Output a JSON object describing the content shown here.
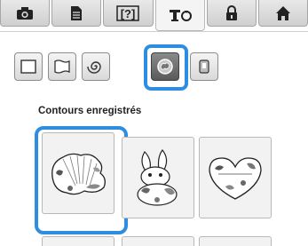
{
  "tabs": [
    {
      "icon": "camera-icon"
    },
    {
      "icon": "document-icon"
    },
    {
      "icon": "unknown-pattern-icon",
      "label": "[?]"
    },
    {
      "icon": "sewing-machine-icon"
    },
    {
      "icon": "lock-icon"
    },
    {
      "icon": "home-icon"
    }
  ],
  "shape_tools": [
    {
      "icon": "square-outline-icon",
      "selected": false
    },
    {
      "icon": "wavy-frame-icon",
      "selected": false
    },
    {
      "icon": "spiral-icon",
      "selected": false
    },
    {
      "icon": "saved-outline-icon",
      "selected": true
    },
    {
      "icon": "frame-icon",
      "selected": false
    }
  ],
  "section": {
    "title": "Contours enregistrés"
  },
  "saved_outlines": [
    {
      "icon": "shell-outline-icon",
      "selected": true
    },
    {
      "icon": "rabbit-outline-icon",
      "selected": false
    },
    {
      "icon": "heart-outline-icon",
      "selected": false
    }
  ],
  "colors": {
    "accent": "#2d8de0"
  }
}
